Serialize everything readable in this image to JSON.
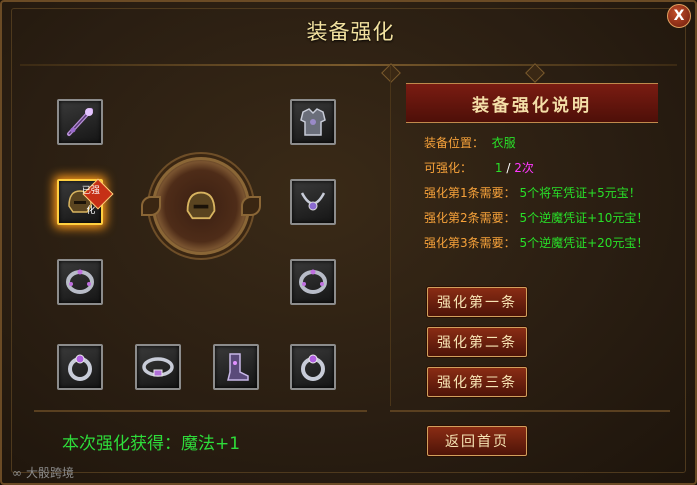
{
  "window": {
    "title": "装备强化",
    "close_symbol": "X"
  },
  "slots": [
    {
      "name": "weapon",
      "icon": "staff-icon"
    },
    {
      "name": "chest",
      "icon": "armor-icon"
    },
    {
      "name": "helmet",
      "icon": "helmet-icon",
      "badge": "已强化"
    },
    {
      "name": "necklace",
      "icon": "necklace-icon"
    },
    {
      "name": "bracelet-left",
      "icon": "bracelet-icon"
    },
    {
      "name": "bracelet-right",
      "icon": "bracelet-icon"
    },
    {
      "name": "ring-left",
      "icon": "ring-icon"
    },
    {
      "name": "belt",
      "icon": "belt-icon"
    },
    {
      "name": "boots",
      "icon": "boots-icon"
    },
    {
      "name": "ring-right",
      "icon": "ring-icon"
    }
  ],
  "info": {
    "header": "装备强化说明",
    "position_label": "装备位置：",
    "position_value": "衣服",
    "enhance_label": "可强化：",
    "enhance_current": "1",
    "enhance_sep": "/",
    "enhance_max": "2次",
    "req1_label": "强化第1条需要：",
    "req1_value": "5个将军凭证+5元宝！",
    "req2_label": "强化第2条需要：",
    "req2_value": "5个逆魔凭证+10元宝！",
    "req3_label": "强化第3条需要：",
    "req3_value": "5个逆魔凭证+20元宝！"
  },
  "buttons": {
    "enhance1": "强化第一条",
    "enhance2": "强化第二条",
    "enhance3": "强化第三条",
    "back": "返回首页"
  },
  "result": {
    "text": "本次强化获得：魔法+1"
  },
  "watermark": {
    "text": "大骰跨境"
  },
  "colors": {
    "label": "#f7a23a",
    "value_green": "#28e028",
    "value_magenta": "#ff38ff",
    "title": "#f3e2a0",
    "banner": "#7a1c12"
  }
}
